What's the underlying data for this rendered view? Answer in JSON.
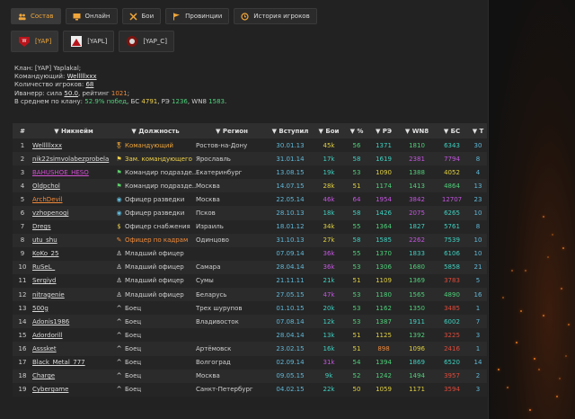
{
  "tabs": [
    {
      "label": "Состав",
      "icon": "users-icon",
      "active": true
    },
    {
      "label": "Онлайн",
      "icon": "monitor-icon"
    },
    {
      "label": "Бои",
      "icon": "swords-icon"
    },
    {
      "label": "Провинции",
      "icon": "flag-icon"
    },
    {
      "label": "История игроков",
      "icon": "history-icon"
    }
  ],
  "clans": [
    {
      "tag": "[YAP]",
      "active": true
    },
    {
      "tag": "[YAPL]"
    },
    {
      "tag": "[YAP_C]"
    }
  ],
  "info": {
    "clan_label": "Клан: [YAP] Yaplakal;",
    "commander_label": "Командующий: ",
    "commander": "Welllllxxx",
    "count_label": "Количество игроков: ",
    "count": "68",
    "ivanerr_label": "Иванерр: сила ",
    "ivanerr_power": "50.0",
    "ivanerr_rating_label": ", рейтинг ",
    "ivanerr_rating": "1021",
    "avg_label": "В среднем по клану: ",
    "avg_win": "52.9% побед",
    "avg_bs_label": ", БС ",
    "avg_bs": "4791",
    "avg_re_label": ", РЭ ",
    "avg_re": "1236",
    "avg_wn8_label": ", WN8 ",
    "avg_wn8": "1583",
    "dot": "."
  },
  "columns": [
    "#",
    "Никнейм",
    "Должность",
    "Регион",
    "Вступил",
    "Бои",
    "%",
    "РЭ",
    "WN8",
    "БС",
    "Т"
  ],
  "colors": {
    "purple": "#c455e0",
    "teal": "#3fd0c0",
    "green": "#4fd07a",
    "yellow": "#e0d040",
    "orange": "#f08a3a",
    "red": "#e04a3a",
    "blue": "#5fb8d8",
    "white": "#e0e0e0"
  },
  "rows": [
    {
      "n": "1",
      "nick": "Welllllxxx",
      "role": "Командующий",
      "role_icon": "leader-icon",
      "region": "Ростов-на-Дону",
      "date": "30.01.13",
      "battles": "45k",
      "pct": "56",
      "re": "1371",
      "wn8": "1810",
      "bs": "6343",
      "t": "30"
    },
    {
      "n": "2",
      "nick": "nik22simvolabezprobela",
      "role": "Зам. командующего",
      "role_icon": "deputy-icon",
      "region": "Ярославль",
      "date": "31.01.14",
      "battles": "17k",
      "pct": "58",
      "re": "1619",
      "wn8": "2381",
      "bs": "7794",
      "t": "8"
    },
    {
      "n": "3",
      "nick": "BAHUSHOE_HESO",
      "role": "Командир подразде...",
      "role_icon": "flag-icon",
      "region": "Екатеринбург",
      "date": "13.08.15",
      "battles": "19k",
      "pct": "53",
      "re": "1090",
      "wn8": "1388",
      "bs": "4052",
      "t": "4"
    },
    {
      "n": "4",
      "nick": "Oldpchol",
      "role": "Командир подразде...",
      "role_icon": "flag-icon",
      "region": "Москва",
      "date": "14.07.15",
      "battles": "28k",
      "pct": "51",
      "re": "1174",
      "wn8": "1413",
      "bs": "4864",
      "t": "13"
    },
    {
      "n": "5",
      "nick": "ArchDevil",
      "role": "Офицер разведки",
      "role_icon": "recon-icon",
      "region": "Москва",
      "date": "22.05.14",
      "battles": "46k",
      "pct": "64",
      "re": "1954",
      "wn8": "3842",
      "bs": "12707",
      "t": "23"
    },
    {
      "n": "6",
      "nick": "vzhopenogi",
      "role": "Офицер разведки",
      "role_icon": "recon-icon",
      "region": "Псков",
      "date": "28.10.13",
      "battles": "18k",
      "pct": "58",
      "re": "1426",
      "wn8": "2075",
      "bs": "6265",
      "t": "10"
    },
    {
      "n": "7",
      "nick": "Dregs",
      "role": "Офицер снабжения",
      "role_icon": "supply-icon",
      "region": "Израиль",
      "date": "18.01.12",
      "battles": "34k",
      "pct": "55",
      "re": "1364",
      "wn8": "1827",
      "bs": "5761",
      "t": "8"
    },
    {
      "n": "8",
      "nick": "utu_shu",
      "role": "Офицер по кадрам",
      "role_icon": "personnel-icon",
      "region": "Одинцово",
      "date": "31.10.13",
      "battles": "27k",
      "pct": "58",
      "re": "1585",
      "wn8": "2262",
      "bs": "7539",
      "t": "10"
    },
    {
      "n": "9",
      "nick": "KoKo_25",
      "role": "Младший офицер",
      "role_icon": "junior-icon",
      "region": "",
      "date": "07.09.14",
      "battles": "36k",
      "pct": "55",
      "re": "1370",
      "wn8": "1833",
      "bs": "6106",
      "t": "10"
    },
    {
      "n": "10",
      "nick": "RuSeL_",
      "role": "Младший офицер",
      "role_icon": "junior-icon",
      "region": "Самара",
      "date": "28.04.14",
      "battles": "36k",
      "pct": "53",
      "re": "1306",
      "wn8": "1680",
      "bs": "5858",
      "t": "21"
    },
    {
      "n": "11",
      "nick": "Sergiyd",
      "role": "Младший офицер",
      "role_icon": "junior-icon",
      "region": "Сумы",
      "date": "21.11.11",
      "battles": "21k",
      "pct": "51",
      "re": "1109",
      "wn8": "1369",
      "bs": "3783",
      "t": "5"
    },
    {
      "n": "12",
      "nick": "nitragenie",
      "role": "Младший офицер",
      "role_icon": "junior-icon",
      "region": "Беларусь",
      "date": "27.05.15",
      "battles": "47k",
      "pct": "53",
      "re": "1180",
      "wn8": "1565",
      "bs": "4890",
      "t": "16"
    },
    {
      "n": "13",
      "nick": "500g",
      "role": "Боец",
      "role_icon": "private-icon",
      "region": "Трех шурупов",
      "date": "01.10.15",
      "battles": "20k",
      "pct": "53",
      "re": "1162",
      "wn8": "1350",
      "bs": "3485",
      "t": "1"
    },
    {
      "n": "14",
      "nick": "Adonis1986",
      "role": "Боец",
      "role_icon": "private-icon",
      "region": "Владивосток",
      "date": "07.08.14",
      "battles": "12k",
      "pct": "53",
      "re": "1387",
      "wn8": "1911",
      "bs": "6002",
      "t": "7"
    },
    {
      "n": "15",
      "nick": "Adordorill",
      "role": "Боец",
      "role_icon": "private-icon",
      "region": "",
      "date": "28.04.14",
      "battles": "13k",
      "pct": "51",
      "re": "1125",
      "wn8": "1392",
      "bs": "3225",
      "t": "3"
    },
    {
      "n": "16",
      "nick": "Asssket",
      "role": "Боец",
      "role_icon": "private-icon",
      "region": "Артёмовск",
      "date": "23.02.15",
      "battles": "16k",
      "pct": "51",
      "re": "898",
      "wn8": "1096",
      "bs": "2416",
      "t": "1"
    },
    {
      "n": "17",
      "nick": "Black_Metal_777",
      "role": "Боец",
      "role_icon": "private-icon",
      "region": "Волгоград",
      "date": "02.09.14",
      "battles": "31k",
      "pct": "54",
      "re": "1394",
      "wn8": "1869",
      "bs": "6520",
      "t": "14"
    },
    {
      "n": "18",
      "nick": "Charge",
      "role": "Боец",
      "role_icon": "private-icon",
      "region": "Москва",
      "date": "09.05.15",
      "battles": "9k",
      "pct": "52",
      "re": "1242",
      "wn8": "1494",
      "bs": "3957",
      "t": "2"
    },
    {
      "n": "19",
      "nick": "Cybergame",
      "role": "Боец",
      "role_icon": "private-icon",
      "region": "Санкт-Петербург",
      "date": "04.02.15",
      "battles": "22k",
      "pct": "50",
      "re": "1059",
      "wn8": "1171",
      "bs": "3594",
      "t": "3"
    }
  ],
  "cell_colors": [
    {
      "battles": "yellow",
      "pct": "green",
      "re": "teal",
      "wn8": "green",
      "bs": "teal"
    },
    {
      "battles": "teal",
      "pct": "teal",
      "re": "teal",
      "wn8": "purple",
      "bs": "purple"
    },
    {
      "battles": "teal",
      "pct": "green",
      "re": "yellow",
      "wn8": "green",
      "bs": "yellow"
    },
    {
      "battles": "yellow",
      "pct": "yellow",
      "re": "green",
      "wn8": "green",
      "bs": "green"
    },
    {
      "battles": "purple",
      "pct": "purple",
      "re": "purple",
      "wn8": "purple",
      "bs": "purple"
    },
    {
      "battles": "teal",
      "pct": "teal",
      "re": "teal",
      "wn8": "purple",
      "bs": "teal"
    },
    {
      "battles": "yellow",
      "pct": "green",
      "re": "green",
      "wn8": "teal",
      "bs": "teal"
    },
    {
      "battles": "yellow",
      "pct": "teal",
      "re": "teal",
      "wn8": "purple",
      "bs": "teal"
    },
    {
      "battles": "purple",
      "pct": "green",
      "re": "green",
      "wn8": "teal",
      "bs": "teal"
    },
    {
      "battles": "purple",
      "pct": "green",
      "re": "green",
      "wn8": "green",
      "bs": "teal"
    },
    {
      "battles": "teal",
      "pct": "yellow",
      "re": "yellow",
      "wn8": "green",
      "bs": "red"
    },
    {
      "battles": "purple",
      "pct": "green",
      "re": "green",
      "wn8": "green",
      "bs": "green"
    },
    {
      "battles": "teal",
      "pct": "green",
      "re": "green",
      "wn8": "green",
      "bs": "red"
    },
    {
      "battles": "teal",
      "pct": "green",
      "re": "green",
      "wn8": "teal",
      "bs": "teal"
    },
    {
      "battles": "teal",
      "pct": "yellow",
      "re": "yellow",
      "wn8": "green",
      "bs": "red"
    },
    {
      "battles": "teal",
      "pct": "yellow",
      "re": "orange",
      "wn8": "yellow",
      "bs": "red"
    },
    {
      "battles": "purple",
      "pct": "green",
      "re": "green",
      "wn8": "teal",
      "bs": "teal"
    },
    {
      "battles": "teal",
      "pct": "green",
      "re": "green",
      "wn8": "green",
      "bs": "red"
    },
    {
      "battles": "teal",
      "pct": "yellow",
      "re": "yellow",
      "wn8": "yellow",
      "bs": "red"
    }
  ]
}
